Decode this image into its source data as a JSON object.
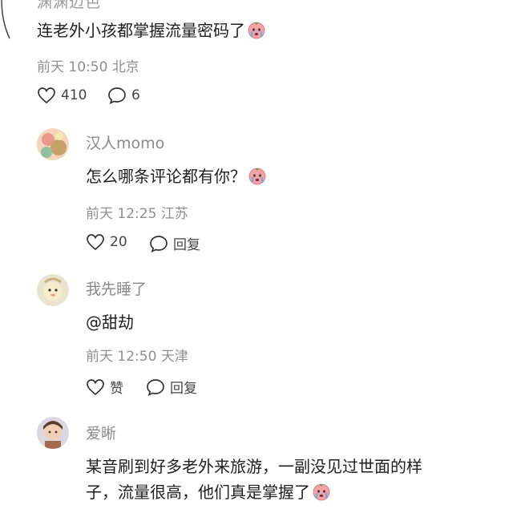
{
  "top_comment": {
    "username_partial": "渊渊迈色",
    "text": "连老外小孩都掌握流量密码了",
    "time": "前天 10:50",
    "location": "北京",
    "likes": "410",
    "replies": "6"
  },
  "replies": [
    {
      "username": "汉人momo",
      "text": "怎么哪条评论都有你？",
      "time": "前天 12:25",
      "location": "江苏",
      "likes": "20",
      "reply_label": "回复"
    },
    {
      "username": "我先睡了",
      "text": "@甜劫",
      "time": "前天 12:50",
      "location": "天津",
      "likes": "赞",
      "reply_label": "回复"
    },
    {
      "username": "爱晰",
      "text_line1": "某音刷到好多老外来旅游，一副没见过世面的样",
      "text_line2": "子，流量很高，他们真是掌握了"
    }
  ],
  "icons": {
    "like": "heart-outline-icon",
    "comment": "speech-bubble-icon",
    "emoji": "crying-face-emoji-icon"
  },
  "colors": {
    "text": "#1f1f1f",
    "meta": "#8f8f8f",
    "username": "#8a8a8a"
  }
}
